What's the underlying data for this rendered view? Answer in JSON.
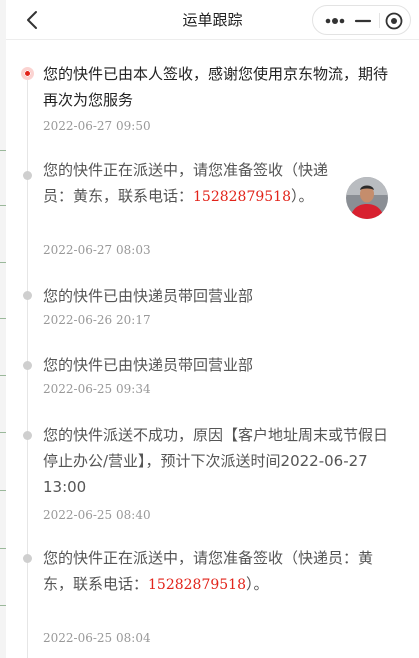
{
  "header": {
    "title": "运单跟踪",
    "back_icon": "chevron-left-icon",
    "more_icon": "more-dots-icon",
    "minimize_icon": "minimize-icon",
    "close_icon": "target-close-icon"
  },
  "colors": {
    "accent": "#e2231a",
    "time": "#999999",
    "rail": "#e6e6e6"
  },
  "events": [
    {
      "message": "您的快件已由本人签收，感谢您使用京东物流，期待再次为您服务",
      "time": "2022-06-27 09:50",
      "current": true
    },
    {
      "message_before": "您的快件正在派送中，请您准备签收（快递员：黄东，联系电话：",
      "phone": "15282879518",
      "message_after": "）。",
      "time": "2022-06-27 08:03"
    },
    {
      "message": "您的快件已由快递员带回营业部",
      "time": "2022-06-26 20:17"
    },
    {
      "message": "您的快件已由快递员带回营业部",
      "time": "2022-06-25 09:34"
    },
    {
      "message": "您的快件派送不成功，原因【客户地址周末或节假日停止办公/营业】，预计下次派送时间2022-06-27 13:00",
      "time": "2022-06-25 08:40"
    },
    {
      "message_before": "您的快件正在派送中，请您准备签收（快递员：黄东，联系电话：",
      "phone": "15282879518",
      "message_after": "）。",
      "time": "2022-06-25 08:04"
    }
  ]
}
